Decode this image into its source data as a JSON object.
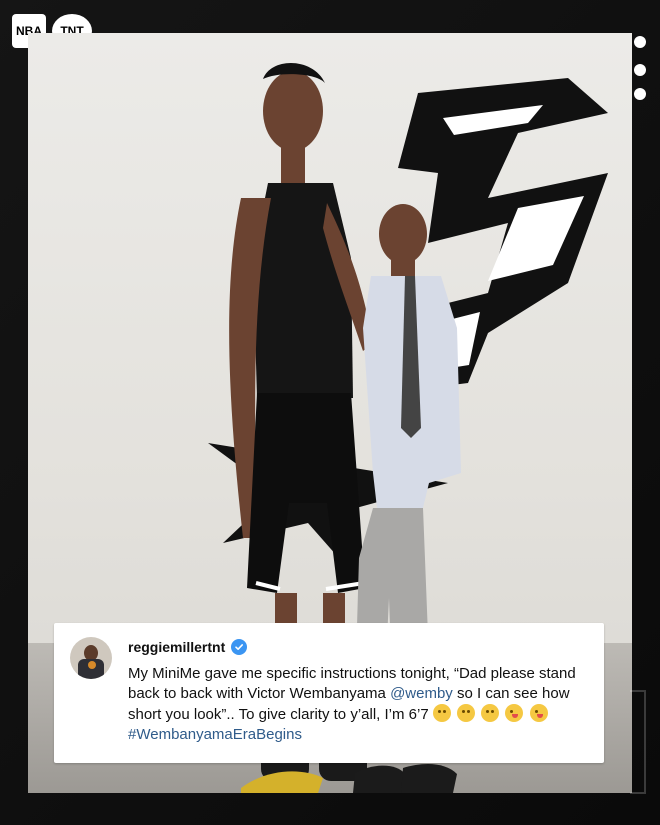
{
  "brand": {
    "nba_label": "NBA",
    "tnt_label": "TNT"
  },
  "post": {
    "username": "reggiemillertnt",
    "caption_parts": {
      "p1": "My MiniMe gave me specific instructions tonight, “Dad please stand back to back with Victor Wembanyama ",
      "mention": "@wemby",
      "p2": " so I can see how short you look”.. To give clarity to y’all, I’m 6’7 ",
      "hashtag": "#WembanyamaEraBegins"
    }
  },
  "icons": {
    "verified": "verified-badge-icon",
    "more": "more-dots-icon",
    "emojis": [
      "thinking-face-emoji",
      "wink-face-emoji",
      "monocle-face-emoji",
      "tongue-wink-emoji",
      "squint-tongue-emoji"
    ]
  },
  "colors": {
    "link": "#2f5b8a",
    "verified": "#3b95f2",
    "background": "#0c0c0c",
    "card": "#ffffff"
  }
}
